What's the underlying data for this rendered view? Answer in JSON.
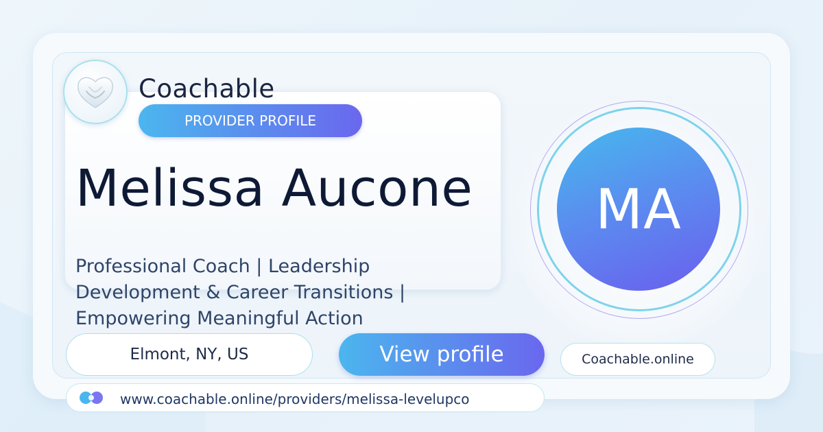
{
  "brand": {
    "name": "Coachable",
    "logo_icon": "heart-hands-icon"
  },
  "profile": {
    "badge": "PROVIDER PROFILE",
    "name": "Melissa Aucone",
    "headline": "Professional Coach | Leadership Development & Career Transitions | Empowering Meaningful Action",
    "initials": "MA",
    "location": "Elmont, NY, US"
  },
  "actions": {
    "view_profile_label": "View profile"
  },
  "site": {
    "domain": "Coachable.online",
    "url": "www.coachable.online/providers/melissa-levelupco",
    "url_icon": "link-circles-icon"
  },
  "colors": {
    "accent_start": "#4bb6ee",
    "accent_end": "#6a67ee",
    "text_dark": "#0e1a35",
    "text_body": "#2f4468"
  }
}
